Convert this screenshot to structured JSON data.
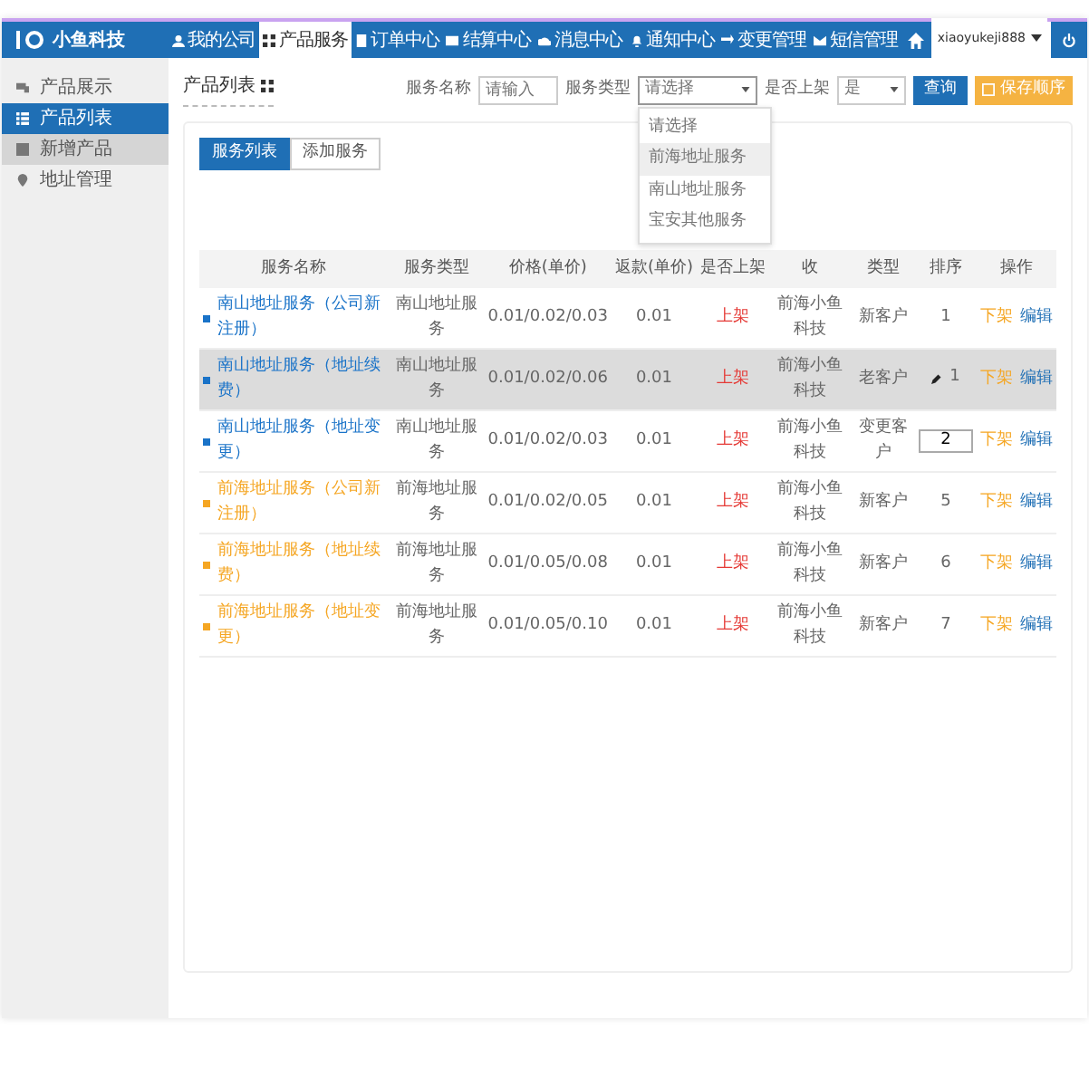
{
  "topbar": {
    "logo_text": "小鱼科技",
    "nav": [
      {
        "label": "我的公司",
        "selected": false
      },
      {
        "label": "产品服务",
        "selected": true
      },
      {
        "label": "订单中心",
        "selected": false
      },
      {
        "label": "结算中心",
        "selected": false
      },
      {
        "label": "消息中心",
        "selected": false
      },
      {
        "label": "通知中心",
        "selected": false
      },
      {
        "label": "变更管理",
        "selected": false
      },
      {
        "label": "短信管理",
        "selected": false
      }
    ],
    "user": "xiaoyukeji888"
  },
  "sidebar": {
    "items": [
      {
        "label": "产品展示",
        "selected": false,
        "hovered": false
      },
      {
        "label": "产品列表",
        "selected": true,
        "hovered": false
      },
      {
        "label": "新增产品",
        "selected": false,
        "hovered": true
      },
      {
        "label": "地址管理",
        "selected": false,
        "hovered": false
      }
    ]
  },
  "main": {
    "title": "产品列表",
    "filters": {
      "name_label": "服务名称",
      "name_placeholder": "请输入",
      "type_label": "服务类型",
      "type_value": "请选择",
      "type_options": [
        {
          "label": "请选择",
          "selected": false
        },
        {
          "label": "前海地址服务",
          "selected": true
        },
        {
          "label": "南山地址服务",
          "selected": false
        },
        {
          "label": "宝安其他服务",
          "selected": false
        }
      ],
      "listed_label": "是否上架",
      "listed_value": "是",
      "search_button": "查询",
      "save_button": "保存顺序"
    },
    "tabs": [
      {
        "label": "服务列表",
        "selected": true
      },
      {
        "label": "添加服务",
        "selected": false
      }
    ],
    "table": {
      "columns": [
        "服务名称",
        "服务类型",
        "价格(单价)",
        "返款(单价)",
        "是否上架",
        "收",
        "类型",
        "排序",
        "操作"
      ],
      "rows": [
        {
          "name": "南山地址服务（公司新注册）",
          "color": "#1a73c8",
          "selected": false,
          "type": "南山地址服务",
          "price": "0.01/0.02/0.03",
          "refund": "0.01",
          "listed": "上架",
          "payee": "前海小鱼科技",
          "customer": "新客户",
          "sort": {
            "kind": "text",
            "value": "1"
          },
          "actions": [
            "下架",
            "编辑"
          ]
        },
        {
          "name": "南山地址服务（地址续费）",
          "color": "#1a73c8",
          "selected": true,
          "type": "南山地址服务",
          "price": "0.01/0.02/0.06",
          "refund": "0.01",
          "listed": "上架",
          "payee": "前海小鱼科技",
          "customer": "老客户",
          "sort": {
            "kind": "edit",
            "value": "1"
          },
          "actions": [
            "下架",
            "编辑"
          ]
        },
        {
          "name": "南山地址服务（地址变更）",
          "color": "#1a73c8",
          "selected": false,
          "type": "南山地址服务",
          "price": "0.01/0.02/0.03",
          "refund": "0.01",
          "listed": "上架",
          "payee": "前海小鱼科技",
          "customer": "变更客户",
          "sort": {
            "kind": "input",
            "value": "2"
          },
          "actions": [
            "下架",
            "编辑"
          ]
        },
        {
          "name": "前海地址服务（公司新注册）",
          "color": "#f5a623",
          "selected": false,
          "type": "前海地址服务",
          "price": "0.01/0.02/0.05",
          "refund": "0.01",
          "listed": "上架",
          "payee": "前海小鱼科技",
          "customer": "新客户",
          "sort": {
            "kind": "text",
            "value": "5"
          },
          "actions": [
            "下架",
            "编辑"
          ]
        },
        {
          "name": "前海地址服务（地址续费）",
          "color": "#f5a623",
          "selected": false,
          "type": "前海地址服务",
          "price": "0.01/0.05/0.08",
          "refund": "0.01",
          "listed": "上架",
          "payee": "前海小鱼科技",
          "customer": "新客户",
          "sort": {
            "kind": "text",
            "value": "6"
          },
          "actions": [
            "下架",
            "编辑"
          ]
        },
        {
          "name": "前海地址服务（地址变更）",
          "color": "#f5a623",
          "selected": false,
          "type": "前海地址服务",
          "price": "0.01/0.05/0.10",
          "refund": "0.01",
          "listed": "上架",
          "payee": "前海小鱼科技",
          "customer": "新客户",
          "sort": {
            "kind": "text",
            "value": "7"
          },
          "actions": [
            "下架",
            "编辑"
          ]
        }
      ]
    }
  }
}
